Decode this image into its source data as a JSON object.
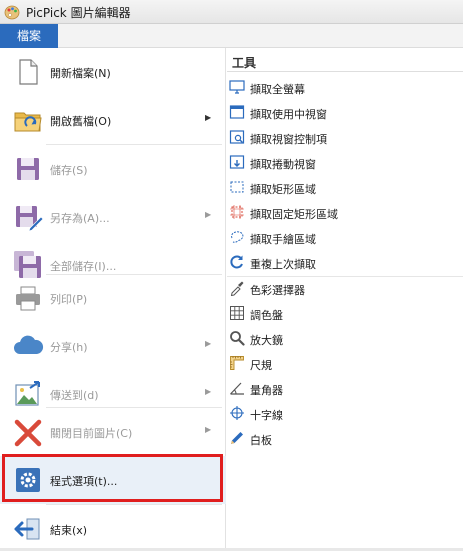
{
  "window": {
    "title": "PicPick 圖片編輯器",
    "app_icon": "palette-icon"
  },
  "ribbon": {
    "file_tab": "檔案"
  },
  "menu": {
    "items": [
      {
        "label": "開新檔案(N)",
        "icon": "new-file-icon",
        "disabled": false,
        "submenu": false
      },
      {
        "label": "開啟舊檔(O)",
        "icon": "open-folder-icon",
        "disabled": false,
        "submenu": true
      },
      {
        "label": "儲存(S)",
        "icon": "save-icon",
        "disabled": true,
        "submenu": false
      },
      {
        "label": "另存為(A)...",
        "icon": "save-as-icon",
        "disabled": true,
        "submenu": true
      },
      {
        "label": "全部儲存(I)...",
        "icon": "save-all-icon",
        "disabled": true,
        "submenu": false
      },
      {
        "label": "列印(P)",
        "icon": "printer-icon",
        "disabled": true,
        "submenu": false
      },
      {
        "label": "分享(h)",
        "icon": "cloud-icon",
        "disabled": true,
        "submenu": true
      },
      {
        "label": "傳送到(d)",
        "icon": "send-to-icon",
        "disabled": true,
        "submenu": true
      },
      {
        "label": "關閉目前圖片(C)",
        "icon": "close-x-icon",
        "disabled": true,
        "submenu": true
      },
      {
        "label": "程式選項(t)...",
        "icon": "gear-icon",
        "disabled": false,
        "submenu": false,
        "highlighted": true
      },
      {
        "label": "結束(x)",
        "icon": "exit-icon",
        "disabled": false,
        "submenu": false
      }
    ]
  },
  "tools": {
    "header": "工具",
    "items": [
      {
        "label": "擷取全螢幕",
        "icon": "monitor-icon"
      },
      {
        "label": "擷取使用中視窗",
        "icon": "window-icon"
      },
      {
        "label": "擷取視窗控制項",
        "icon": "window-control-icon"
      },
      {
        "label": "擷取捲動視窗",
        "icon": "scroll-window-icon"
      },
      {
        "label": "擷取矩形區域",
        "icon": "rect-region-icon"
      },
      {
        "label": "擷取固定矩形區域",
        "icon": "fixed-rect-icon"
      },
      {
        "label": "擷取手繪區域",
        "icon": "freehand-icon"
      },
      {
        "label": "重複上次擷取",
        "icon": "repeat-icon"
      },
      {
        "label": "色彩選擇器",
        "icon": "eyedropper-icon"
      },
      {
        "label": "調色盤",
        "icon": "palette-grid-icon"
      },
      {
        "label": "放大鏡",
        "icon": "magnifier-icon"
      },
      {
        "label": "尺規",
        "icon": "ruler-icon"
      },
      {
        "label": "量角器",
        "icon": "protractor-icon"
      },
      {
        "label": "十字線",
        "icon": "crosshair-icon"
      },
      {
        "label": "白板",
        "icon": "whiteboard-pen-icon"
      }
    ]
  },
  "colors": {
    "accent": "#2b6bbd",
    "highlight_border": "#e01e1e",
    "disabled_text": "#9a9a9a"
  }
}
